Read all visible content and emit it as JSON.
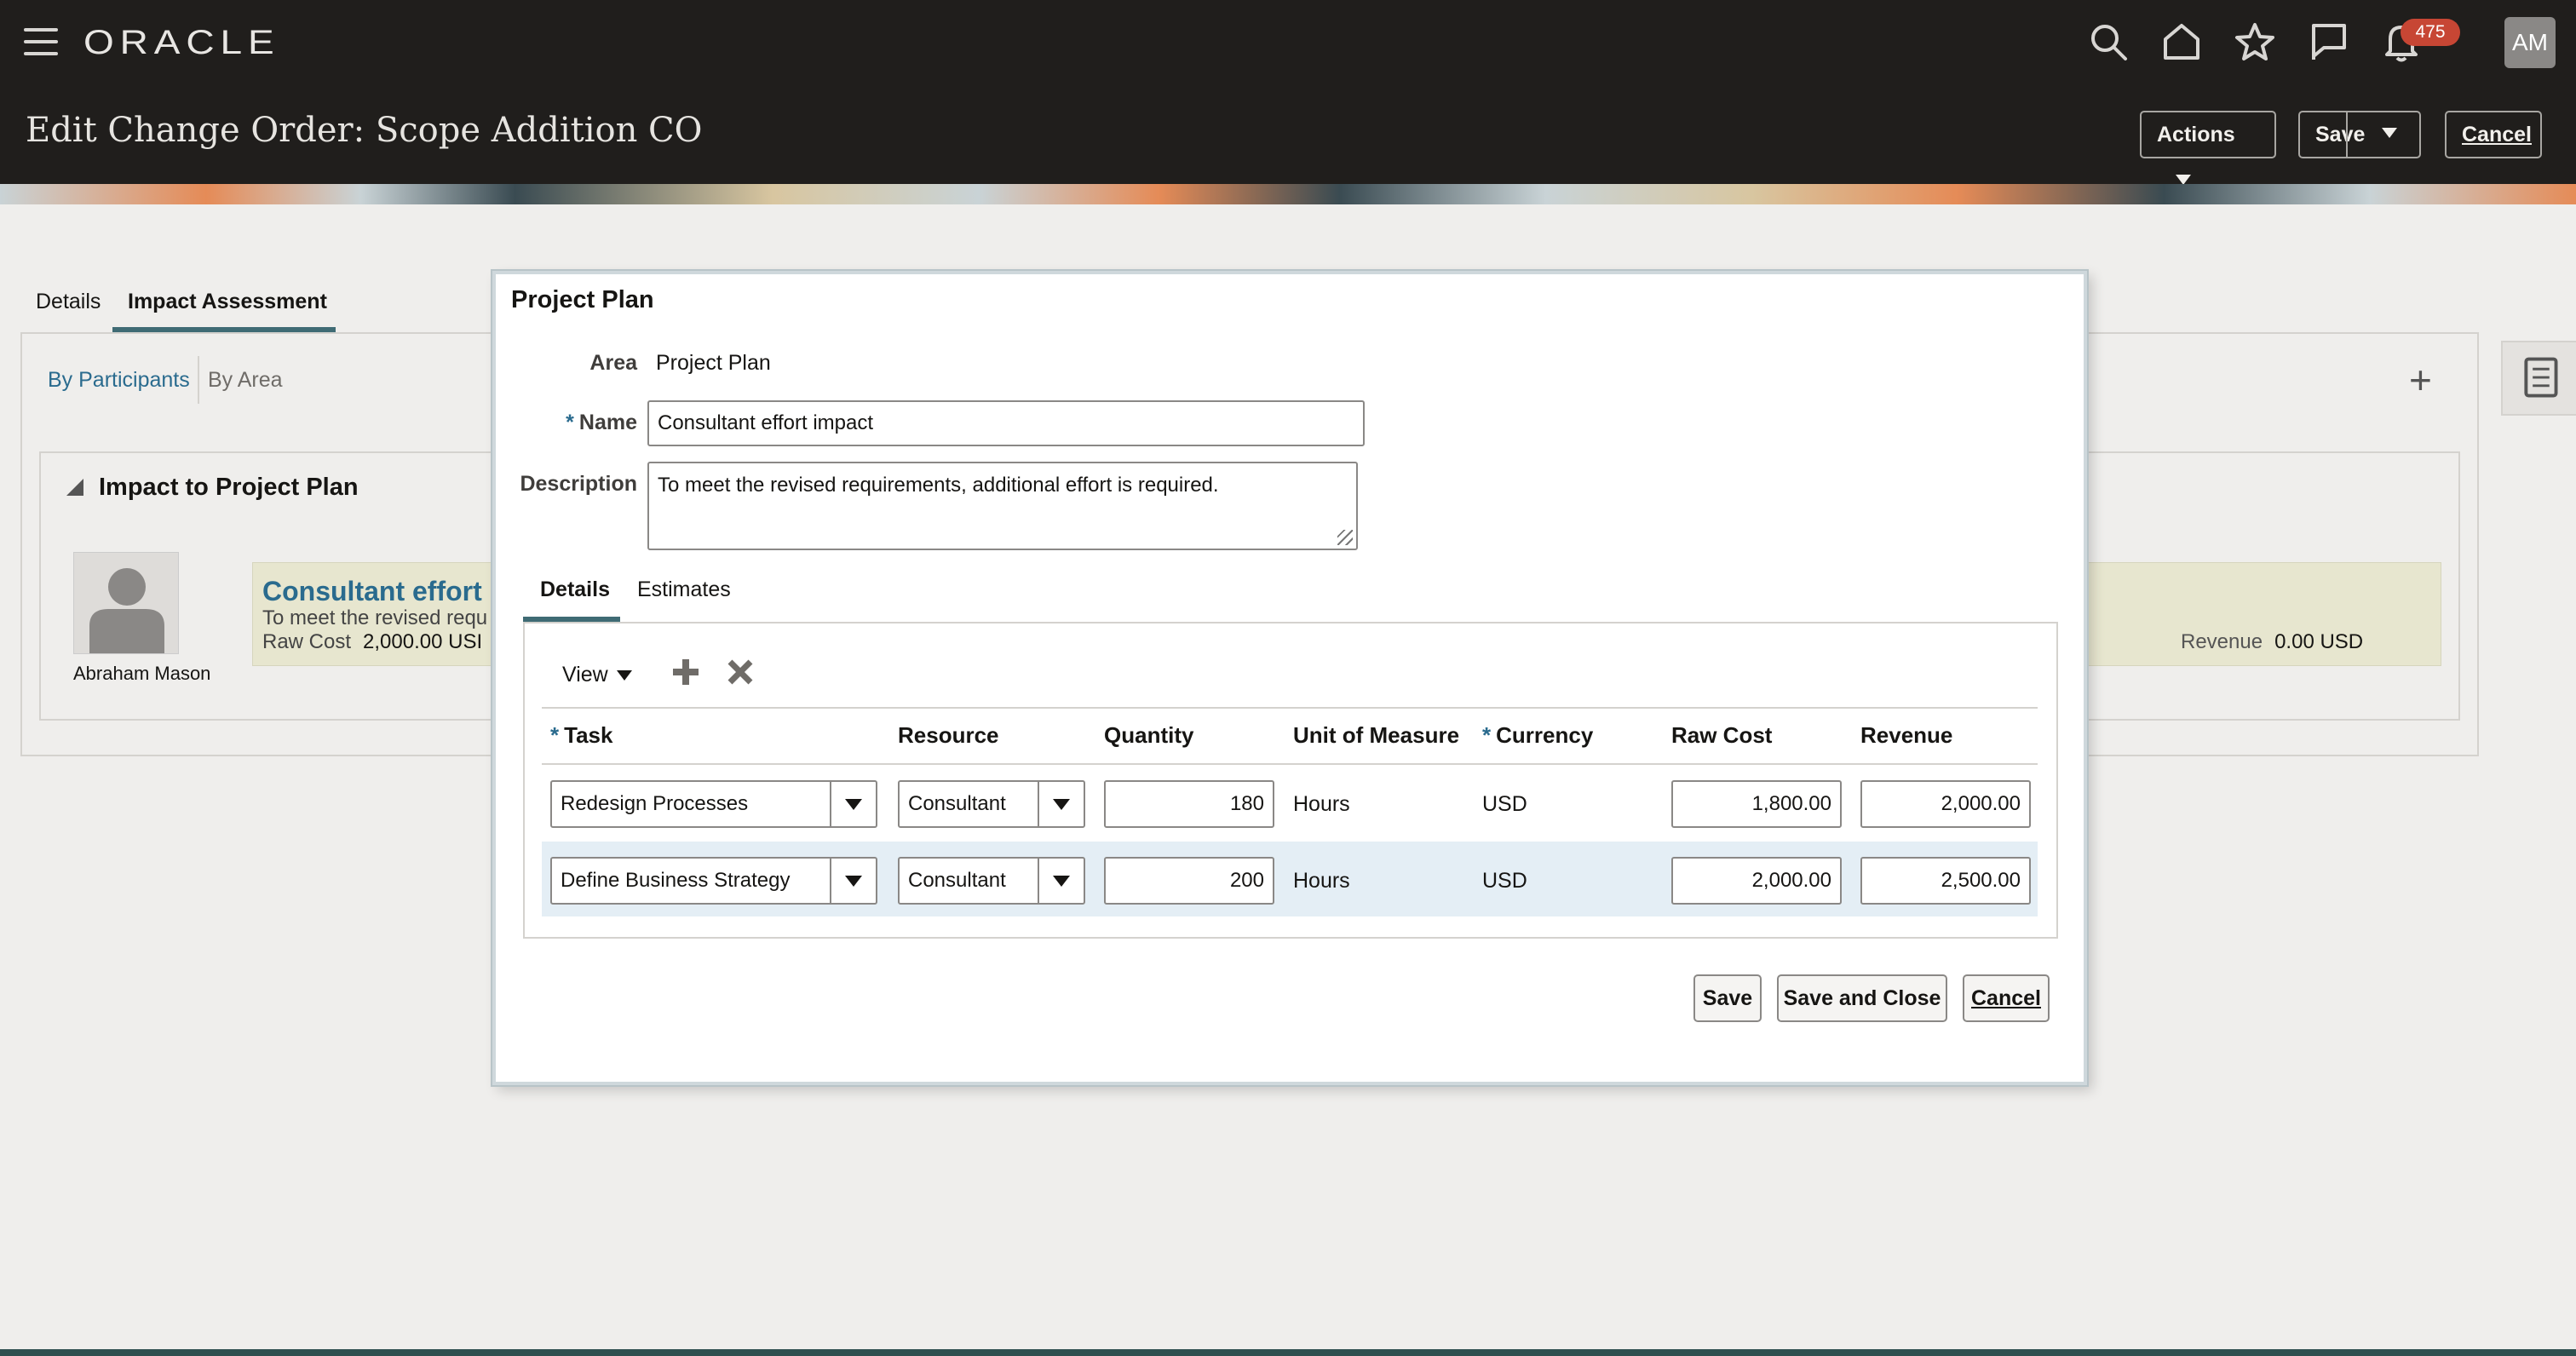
{
  "header": {
    "logo": "ORACLE",
    "notification_count": "475",
    "avatar_initials": "AM",
    "page_title": "Edit Change Order: Scope Addition CO",
    "actions_label": "Actions",
    "save_label": "Save",
    "cancel_label": "Cancel",
    "icons": [
      "menu-icon",
      "search-icon",
      "home-icon",
      "star-icon",
      "flag-icon",
      "bell-icon"
    ]
  },
  "background": {
    "tabs": [
      "Details",
      "Impact Assessment"
    ],
    "active_tab": "Impact Assessment",
    "filters": [
      "By Participants",
      "By Area"
    ],
    "section_title": "Impact to Project Plan",
    "person_name": "Abraham Mason",
    "card": {
      "title": "Consultant effort ir",
      "description": "To meet the revised requ",
      "raw_cost_label": "Raw Cost",
      "raw_cost_value": "2,000.00 USI",
      "revenue_label": "Revenue",
      "revenue_value": "0.00 USD"
    }
  },
  "modal": {
    "title": "Project Plan",
    "area_label": "Area",
    "area_value": "Project Plan",
    "name_label": "Name",
    "name_value": "Consultant effort impact",
    "description_label": "Description",
    "description_value": "To meet the revised requirements, additional effort is required.",
    "tabs": [
      "Details",
      "Estimates"
    ],
    "active_tab": "Details",
    "view_label": "View",
    "columns": [
      "Task",
      "Resource",
      "Quantity",
      "Unit of Measure",
      "Currency",
      "Raw Cost",
      "Revenue"
    ],
    "rows": [
      {
        "task": "Redesign Processes",
        "resource": "Consultant",
        "quantity": "180",
        "uom": "Hours",
        "currency": "USD",
        "raw_cost": "1,800.00",
        "revenue": "2,000.00"
      },
      {
        "task": "Define Business Strategy",
        "resource": "Consultant",
        "quantity": "200",
        "uom": "Hours",
        "currency": "USD",
        "raw_cost": "2,000.00",
        "revenue": "2,500.00"
      }
    ],
    "buttons": {
      "save": "Save",
      "save_close": "Save and Close",
      "cancel": "Cancel"
    }
  },
  "colors": {
    "accent": "#2a6b8e",
    "header_bg": "#201e1c",
    "selected_row": "#e4eef5",
    "badge": "#c74634"
  }
}
